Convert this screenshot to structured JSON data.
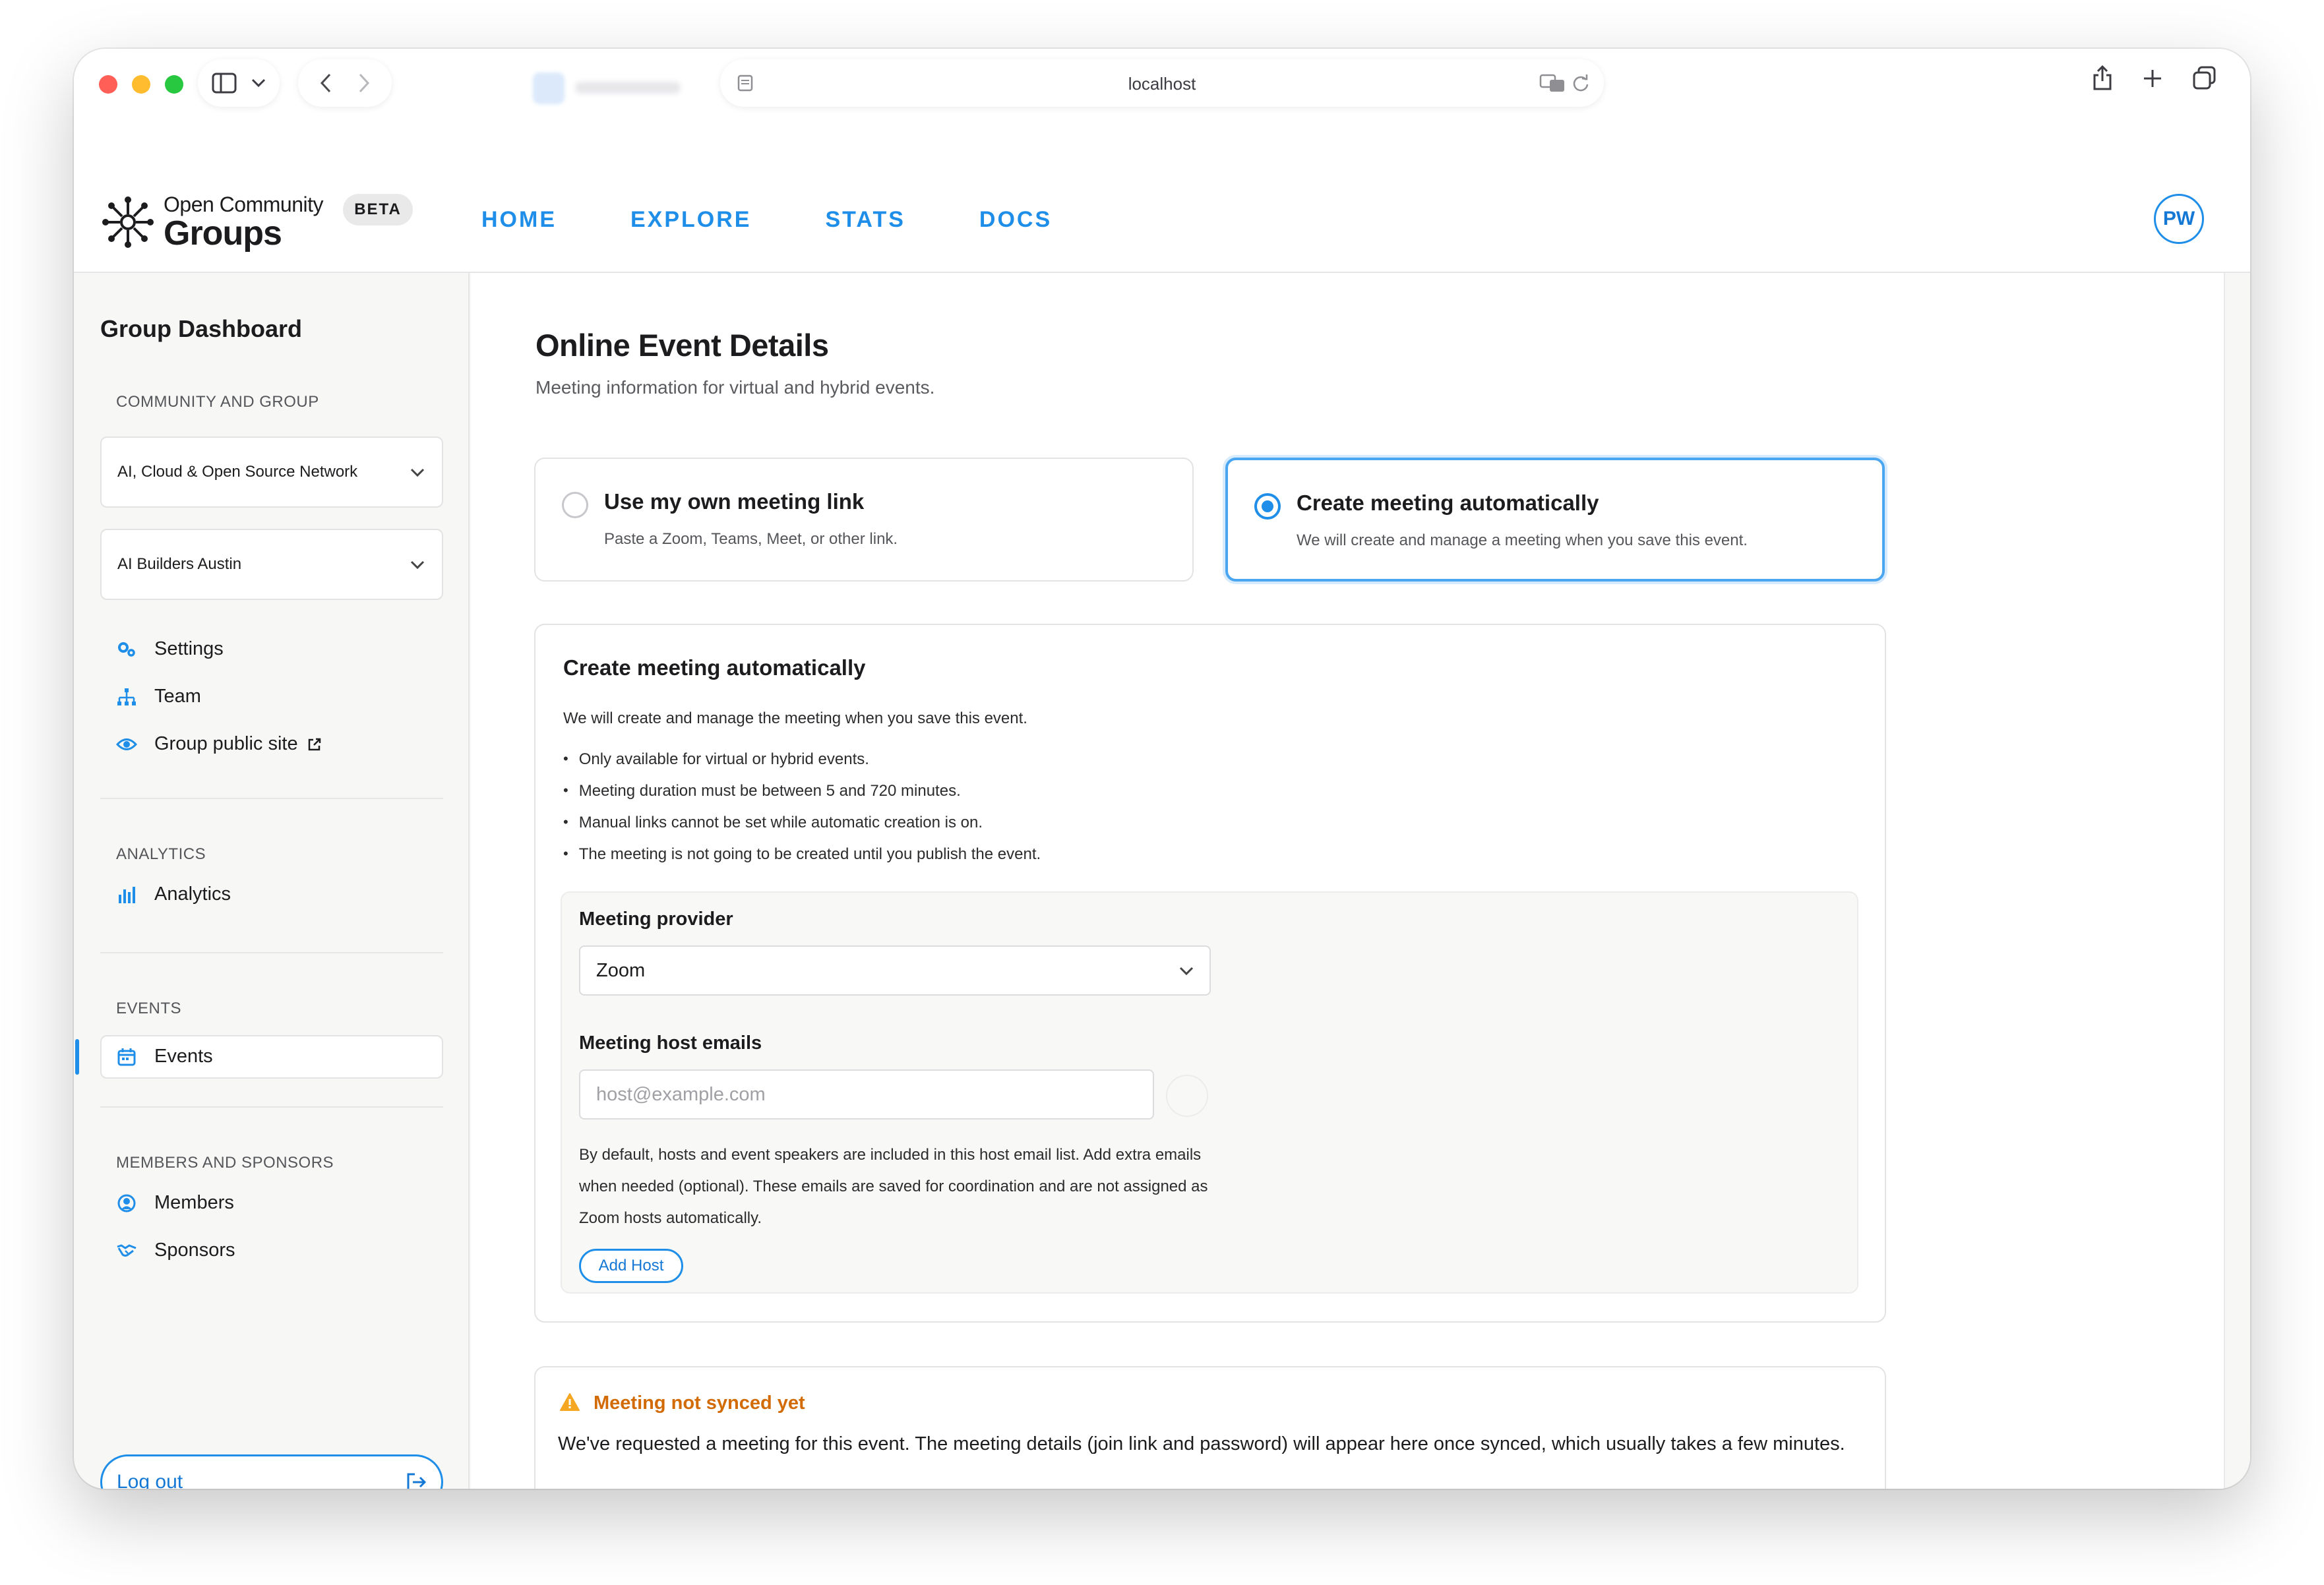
{
  "browser": {
    "url": "localhost",
    "icons": [
      "sidebar-icon",
      "chevron-down-icon",
      "back-icon",
      "forward-icon",
      "page-icon",
      "translate-icon",
      "reload-icon",
      "share-icon",
      "plus-icon",
      "tabs-icon"
    ]
  },
  "header": {
    "logo_line1": "Open Community",
    "logo_line2": "Groups",
    "badge": "BETA",
    "nav": [
      "HOME",
      "EXPLORE",
      "STATS",
      "DOCS"
    ],
    "avatar_initials": "PW"
  },
  "sidebar": {
    "title": "Group Dashboard",
    "section_community": "COMMUNITY AND GROUP",
    "community_select": "AI, Cloud & Open Source Network",
    "group_select": "AI Builders Austin",
    "items_group": [
      {
        "label": "Settings",
        "icon": "gear-icon"
      },
      {
        "label": "Team",
        "icon": "org-chart-icon"
      },
      {
        "label": "Group public site",
        "icon": "eye-icon"
      }
    ],
    "section_analytics": "ANALYTICS",
    "analytics_item": "Analytics",
    "section_events": "EVENTS",
    "events_item": "Events",
    "section_members": "MEMBERS AND SPONSORS",
    "members_item": "Members",
    "sponsors_item": "Sponsors",
    "logout": "Log out"
  },
  "main": {
    "title": "Online Event Details",
    "subtitle": "Meeting information for virtual and hybrid events.",
    "options": [
      {
        "title": "Use my own meeting link",
        "desc": "Paste a Zoom, Teams, Meet, or other link.",
        "selected": false
      },
      {
        "title": "Create meeting automatically",
        "desc": "We will create and manage a meeting when you save this event.",
        "selected": true
      }
    ],
    "auto": {
      "title": "Create meeting automatically",
      "desc": "We will create and manage the meeting when you save this event.",
      "bullets": [
        "Only available for virtual or hybrid events.",
        "Meeting duration must be between 5 and 720 minutes.",
        "Manual links cannot be set while automatic creation is on.",
        "The meeting is not going to be created until you publish the event."
      ],
      "provider_label": "Meeting provider",
      "provider_value": "Zoom",
      "host_label": "Meeting host emails",
      "host_placeholder": "host@example.com",
      "help_text": "By default, hosts and event speakers are included in this host email list. Add extra emails when needed (optional). These emails are saved for coordination and are not assigned as Zoom hosts automatically.",
      "add_host": "Add Host"
    },
    "notice": {
      "title": "Meeting not synced yet",
      "body": "We've requested a meeting for this event. The meeting details (join link and password) will appear here once synced, which usually takes a few minutes.",
      "color": "#d26a06"
    }
  },
  "colors": {
    "accent": "#1f8ee8",
    "warning": "#f5a623"
  }
}
